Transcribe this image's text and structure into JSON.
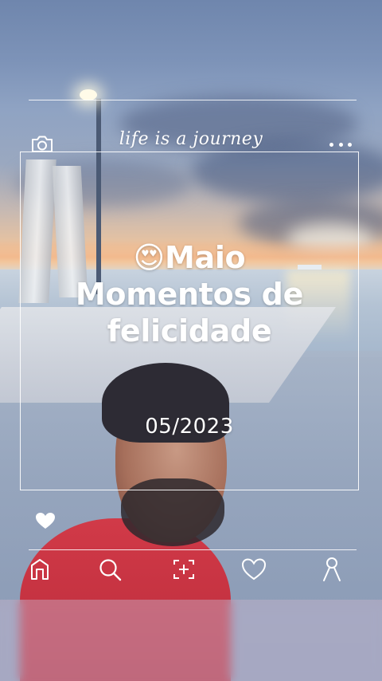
{
  "header": {
    "brand": "life is a journey",
    "camera_icon": "camera-icon",
    "more_icon": "more-icon"
  },
  "card": {
    "emoji": "😍",
    "title_line1": "Maio",
    "title_line2": "Momentos de",
    "title_line3": "felicidade",
    "date": "05/2023",
    "like_icon": "heart-icon"
  },
  "bottom_nav": {
    "items": [
      {
        "id": "home",
        "icon": "home-icon"
      },
      {
        "id": "search",
        "icon": "search-icon"
      },
      {
        "id": "add",
        "icon": "add-icon"
      },
      {
        "id": "likes",
        "icon": "heart-icon"
      },
      {
        "id": "profile",
        "icon": "profile-icon"
      }
    ]
  },
  "colors": {
    "overlay_text": "#ffffff",
    "shirt": "#c9343f",
    "sky_top": "#6f86ad",
    "sunset": "#f1d7b4"
  }
}
